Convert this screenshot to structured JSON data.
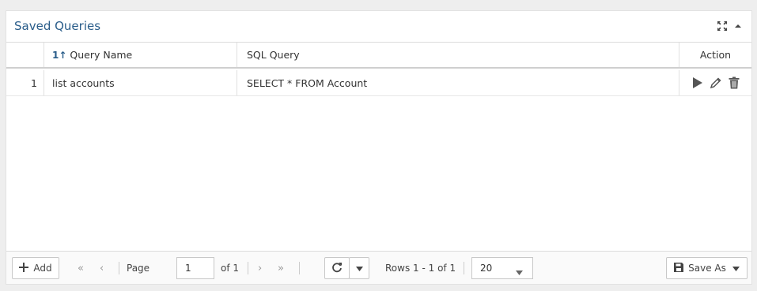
{
  "panel": {
    "title": "Saved Queries",
    "icons": [
      "expand-icon",
      "collapse-up-icon"
    ]
  },
  "table": {
    "columns": {
      "name": "Query Name",
      "sort_indicator": "1↑",
      "sql": "SQL Query",
      "action": "Action"
    },
    "rows": [
      {
        "num": "1",
        "name": "list accounts",
        "sql": "SELECT * FROM Account",
        "actions": [
          "run-icon",
          "edit-icon",
          "delete-icon"
        ]
      }
    ]
  },
  "footer": {
    "add_label": "Add",
    "page_label": "Page",
    "page_value": "1",
    "of_label": "of 1",
    "rows_label": "Rows 1 - 1 of 1",
    "page_size": "20",
    "save_as_label": "Save As"
  },
  "colors": {
    "title": "#2a5d8a",
    "icon": "#555555"
  }
}
